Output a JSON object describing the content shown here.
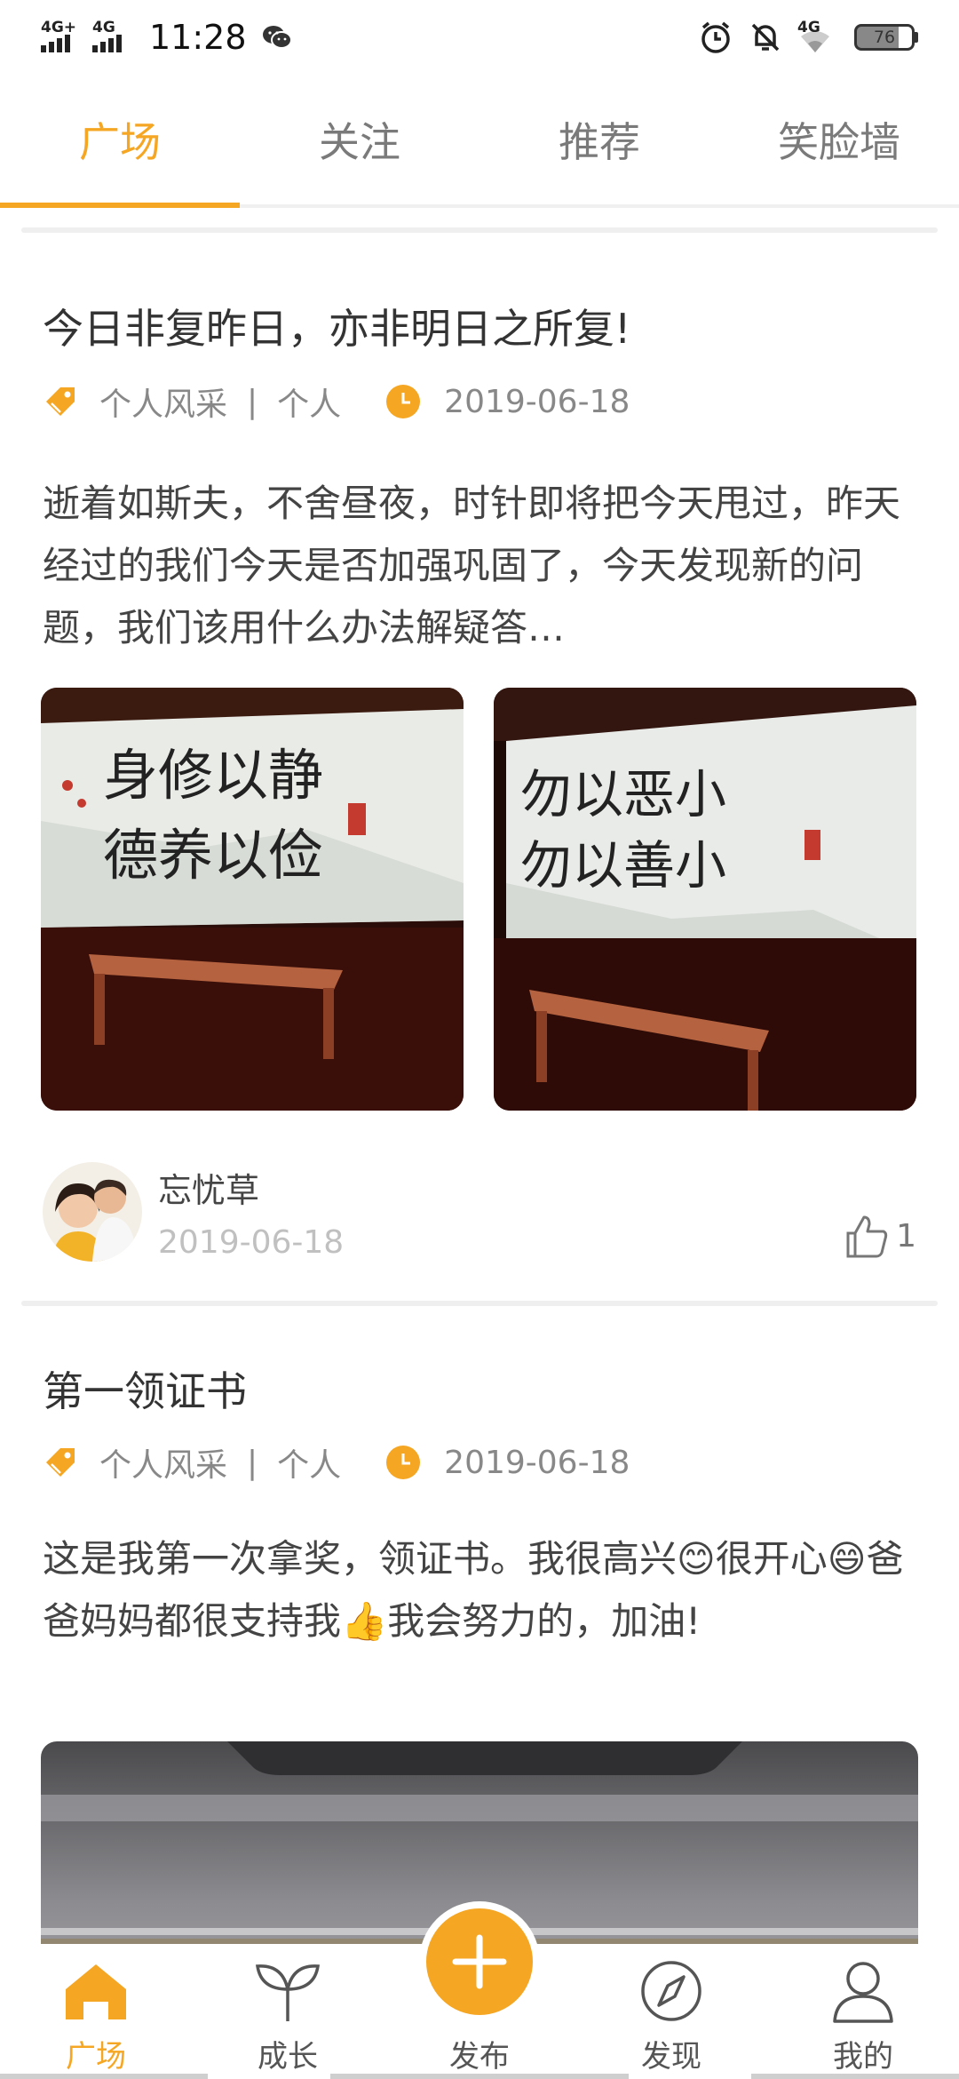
{
  "status_bar": {
    "time": "11:28",
    "signal1": "4G+",
    "signal2": "4G",
    "signal3": "4G",
    "battery": "76",
    "icons": [
      "wechat-icon",
      "alarm-icon",
      "mute-icon",
      "wifi-icon"
    ]
  },
  "tabs": [
    "广场",
    "关注",
    "推荐",
    "笑脸墙"
  ],
  "posts": [
    {
      "title": "今日非复昨日，亦非明日之所复!",
      "category": "个人风采",
      "scope": "个人",
      "date": "2019-06-18",
      "body": "逝着如斯夫，不舍昼夜，时针即将把今天甩过，昨天经过的我们今天是否加强巩固了，今天发现新的问题，我们该用什么办法解疑答…",
      "author": "忘忧草",
      "author_date": "2019-06-18",
      "likes": "1"
    },
    {
      "title": "第一领证书",
      "category": "个人风采",
      "scope": "个人",
      "date": "2019-06-18",
      "body": "这是我第一次拿奖，领证书。我很高兴😊很开心😄爸爸妈妈都很支持我👍我会努力的，加油!"
    }
  ],
  "nav": [
    "广场",
    "成长",
    "发布",
    "发现",
    "我的"
  ],
  "colors": {
    "accent": "#f5a623",
    "text": "#333333",
    "muted": "#888888"
  }
}
